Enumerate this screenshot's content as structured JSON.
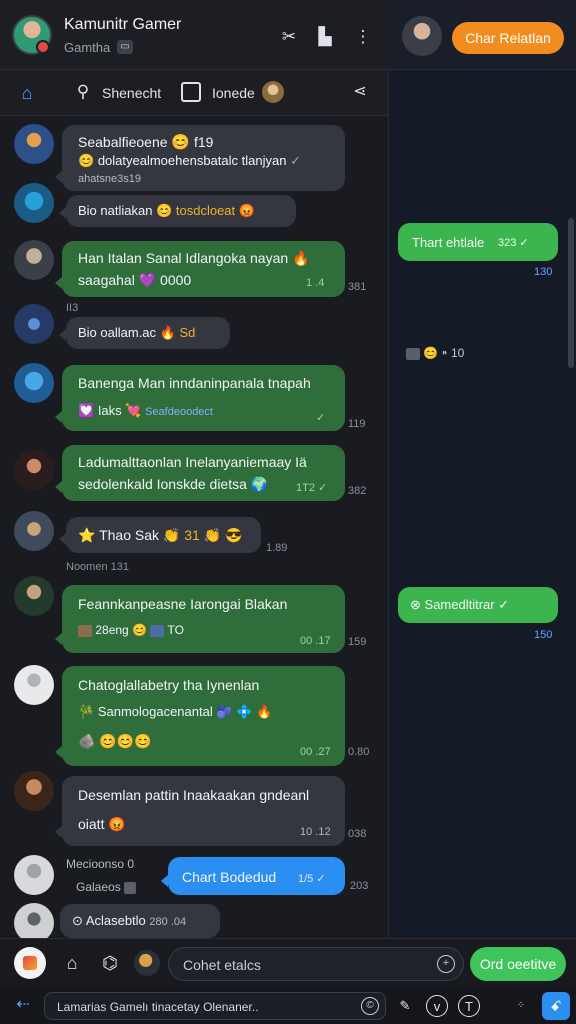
{
  "header": {
    "title": "Kamunitr Gamer",
    "subtitle": "Gamtha",
    "subtitle_icon": "▭",
    "icons": [
      "scissors-icon",
      "bookmark-icon",
      "more-vert-icon"
    ]
  },
  "right_header": {
    "button_label": "Char Relatlan"
  },
  "nav": {
    "search_label": "Shenecht",
    "box_label": "Ionede"
  },
  "messages": [
    {
      "line1": "Seabalfieoene",
      "line1_suffix": "f19",
      "line2": "dolatyealmoehensbatalc tlanjyan",
      "meta": "ahatsne3s19"
    },
    {
      "line1": "Bio natliakan",
      "line1_suffix": "tosdcloeat",
      "meta": ""
    },
    {
      "line1": "Han Italan Sanal Idlangoka nayan",
      "line2": "saagahal",
      "line2_suffix": "0000",
      "meta": "1 .4",
      "out": "381"
    },
    {
      "pre": "II3",
      "line1": "Bio oallam.ac",
      "line1_suffix": "Sd",
      "meta": ""
    },
    {
      "line1": "Banenga Man inndaninpanala tnapah",
      "line2": "Iaks",
      "line2_suffix": "Seafdeoodect",
      "out": "119"
    },
    {
      "line1": "Ladumalttaonlan Inelanyaniemaay Iä",
      "line2": "sedolenkald Ionskde dietsa",
      "meta": "1T2",
      "out": "382"
    },
    {
      "line1": "Thao Sak",
      "line1_suffix": "31",
      "out": "1.89"
    },
    {
      "pre": "Noomen 131",
      "line1": "Feannkanpeasne Iarongai Blakan",
      "line2": "28eng",
      "line2_suffix": "TO",
      "meta": "00 .17",
      "out": "159"
    },
    {
      "line1": "Chatoglallabetry tha Iynenlan",
      "line2": "Sanmologacenantal",
      "meta": "00 .27",
      "out": "0.80"
    },
    {
      "line1": "Desemlan pattin Inaakaakan gndeanl",
      "line2": "oiatt",
      "meta": "10 .12",
      "out": "038"
    },
    {
      "pre1": "Mecioonso",
      "pre1_suffix": "0",
      "pre2": "Galaeos",
      "line1": "Chart Bodedud",
      "meta": "1/5",
      "out": "203"
    },
    {
      "line1": "Aclasebtlo",
      "line1_suffix": "280 .04"
    }
  ],
  "right_messages": [
    {
      "text": "Thart ehtlale",
      "meta": "323",
      "time": "130"
    },
    {
      "text": "10"
    },
    {
      "text": "Samedltitrar",
      "time": "150"
    }
  ],
  "composer": {
    "placeholder": "Cohet etalcs",
    "send_label": "Ord oeetitve"
  },
  "bottom": {
    "field_text": "Lamarias Gamelı tinacetay Olenaner.."
  },
  "colors": {
    "accent_orange": "#f28c1e",
    "bubble_green": "#2f6e3a",
    "bubble_gray": "#34373f",
    "accent_blue": "#2b8ff2",
    "send_green": "#3ec45a"
  }
}
